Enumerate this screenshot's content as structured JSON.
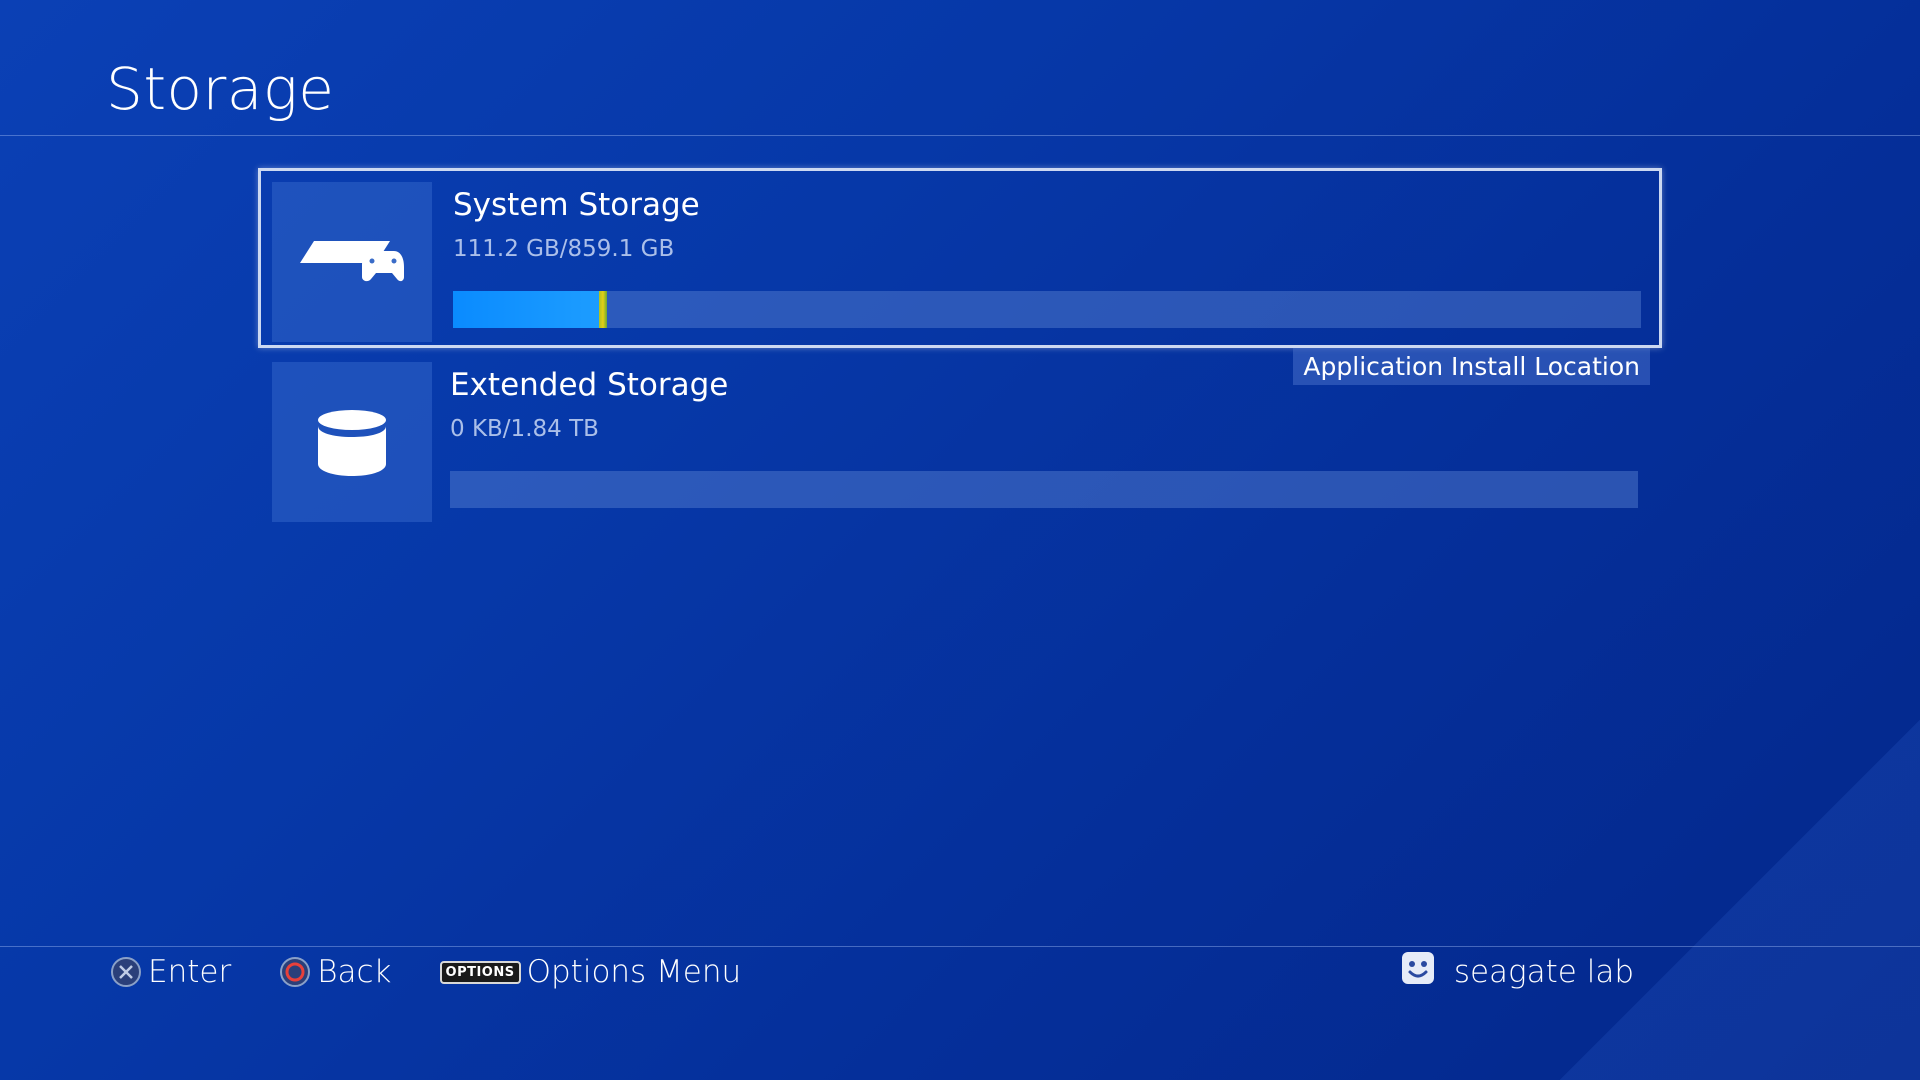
{
  "page": {
    "title": "Storage"
  },
  "storage_items": [
    {
      "name": "System Storage",
      "usage": "111.2 GB/859.1 GB",
      "icon": "ps4-console-icon",
      "used_fraction": 0.1294,
      "selected": true
    },
    {
      "name": "Extended Storage",
      "usage": "0 KB/1.84 TB",
      "icon": "external-drive-icon",
      "used_fraction": 0,
      "badge": "Application Install Location",
      "selected": false
    }
  ],
  "footer": {
    "enter_label": "Enter",
    "back_label": "Back",
    "options_glyph": "OPTIONS",
    "options_label": "Options Menu",
    "user_name": "seagate lab"
  },
  "colors": {
    "bar_fill": "#0a8bff",
    "cross_button": "#8aa0c8",
    "circle_button": "#e8403a"
  }
}
